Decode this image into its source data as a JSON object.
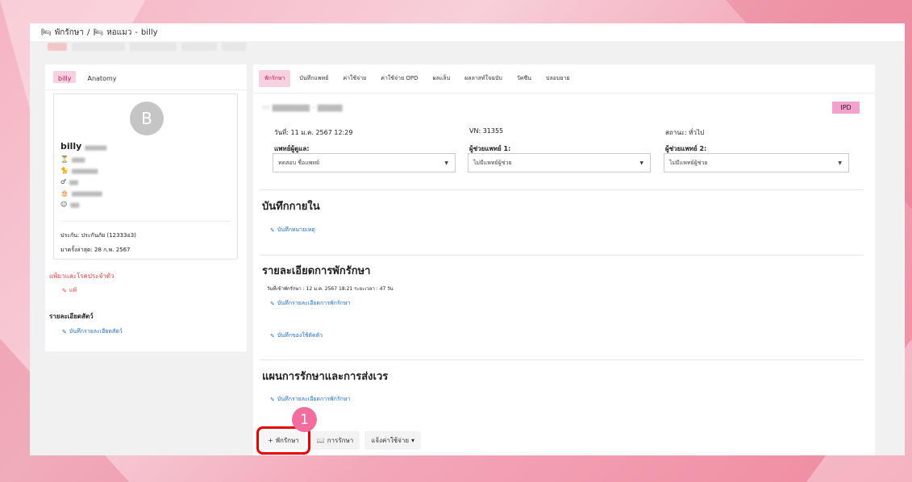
{
  "breadcrumb": {
    "icon_ward": "bed-icon",
    "ward": "พักรักษา",
    "sep": "/",
    "icon_sub": "bed-icon",
    "sub": "หอแมว",
    "dash": "-",
    "patient": "billy"
  },
  "left": {
    "tabs": [
      "billy",
      "Anatomy"
    ],
    "avatar_letter": "B",
    "name": "billy",
    "insurance": "ประกัน: ประกันภัย (12333อ3)",
    "last_visit": "มาครั้งล่าสุด: 28 ก.พ. 2567",
    "allergy_header": "แพ้ยาและโรคประจำตัว",
    "allergy_link": "แพ้",
    "animal_header": "รายละเอียดสัตว์",
    "animal_link": "บันทึกรายละเอียดสัตว์"
  },
  "main": {
    "tabs": [
      "พักรักษา",
      "บันทึกแพทย์",
      "ค่าใช้จ่าย",
      "ค่าใช้จ่าย OPD",
      "ผลแล็บ",
      "ผลลาสท์ใจฉบับ",
      "วัคซีน",
      "ปลอบยาย"
    ],
    "badge": "IPD",
    "date": "วันที่: 11 ม.ค. 2567 12:29",
    "vn": "VN: 31355",
    "status": "สถานะ: ทั่วไป",
    "doctor_label": "แพทย์ผู้ดูแล:",
    "doctor_value": "ทดสอบ ชื่อแพทย์",
    "assist1_label": "ผู้ช่วยแพทย์ 1:",
    "assist1_value": "ไม่มีแพทย์ผู้ช่วย",
    "assist2_label": "ผู้ช่วยแพทย์ 2:",
    "assist2_value": "ไม่มีแพทย์ผู้ช่วย",
    "sec_internal": "บันทึกกายใน",
    "link_internal": "บันทึกหมายเหตุ",
    "sec_detail": "รายละเอียดการพักรักษา",
    "admit_text": "วันที่เข้าพักรักษา : 12 ม.ค. 2567 18:21 ระยะเวลา : 47 วัน",
    "link_detail": "บันทึกรายละเอียดการพักรักษา",
    "link_belongings": "บันทึกของใช้ติดตัว",
    "sec_plan": "แผนการรักษาและการส่งเวร",
    "link_plan": "บันทึกรายละเอียดการพักรักษา",
    "btn_add": "พักรักษา",
    "btn_treat": "การรักษา",
    "btn_cost": "แจ้งค่าใช้จ่าย",
    "step_number": "1"
  }
}
